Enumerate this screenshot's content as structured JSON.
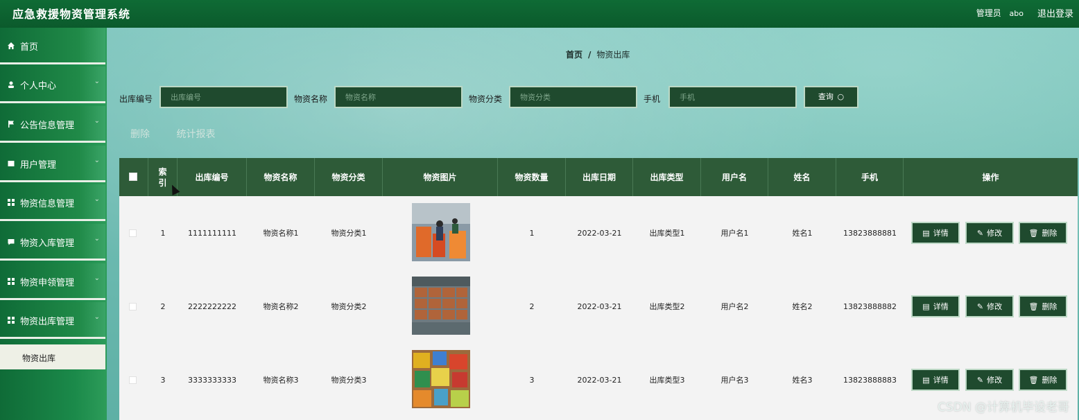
{
  "header": {
    "title": "应急救援物资管理系统",
    "admin_label": "管理员",
    "username": "abo",
    "logout": "退出登录"
  },
  "sidebar": {
    "items": [
      {
        "label": "首页",
        "icon": "home-icon"
      },
      {
        "label": "个人中心",
        "icon": "user-icon"
      },
      {
        "label": "公告信息管理",
        "icon": "flag-icon"
      },
      {
        "label": "用户管理",
        "icon": "square-icon"
      },
      {
        "label": "物资信息管理",
        "icon": "grid-icon"
      },
      {
        "label": "物资入库管理",
        "icon": "message-icon"
      },
      {
        "label": "物资申领管理",
        "icon": "grid-icon"
      },
      {
        "label": "物资出库管理",
        "icon": "grid-icon"
      }
    ],
    "sub_item": "物资出库"
  },
  "breadcrumb": {
    "home": "首页",
    "sep": "/",
    "current": "物资出库"
  },
  "search": {
    "fields": [
      {
        "label": "出库编号",
        "placeholder": "出库编号"
      },
      {
        "label": "物资名称",
        "placeholder": "物资名称"
      },
      {
        "label": "物资分类",
        "placeholder": "物资分类"
      },
      {
        "label": "手机",
        "placeholder": "手机"
      }
    ],
    "button": "查询"
  },
  "actions": {
    "delete": "删除",
    "report": "统计报表"
  },
  "table": {
    "columns": [
      "索引",
      "出库编号",
      "物资名称",
      "物资分类",
      "物资图片",
      "物资数量",
      "出库日期",
      "出库类型",
      "用户名",
      "姓名",
      "手机",
      "操作"
    ],
    "rows": [
      {
        "index": "1",
        "code": "1111111111",
        "name": "物资名称1",
        "category": "物资分类1",
        "qty": "1",
        "date": "2022-03-21",
        "type": "出库类型1",
        "username": "用户名1",
        "realname": "姓名1",
        "phone": "13823888881"
      },
      {
        "index": "2",
        "code": "2222222222",
        "name": "物资名称2",
        "category": "物资分类2",
        "qty": "2",
        "date": "2022-03-21",
        "type": "出库类型2",
        "username": "用户名2",
        "realname": "姓名2",
        "phone": "13823888882"
      },
      {
        "index": "3",
        "code": "3333333333",
        "name": "物资名称3",
        "category": "物资分类3",
        "qty": "3",
        "date": "2022-03-21",
        "type": "出库类型3",
        "username": "用户名3",
        "realname": "姓名3",
        "phone": "13823888883"
      }
    ],
    "op_buttons": {
      "detail": "详情",
      "edit": "修改",
      "delete": "删除"
    }
  },
  "watermark": "CSDN @计算机毕设老哥"
}
